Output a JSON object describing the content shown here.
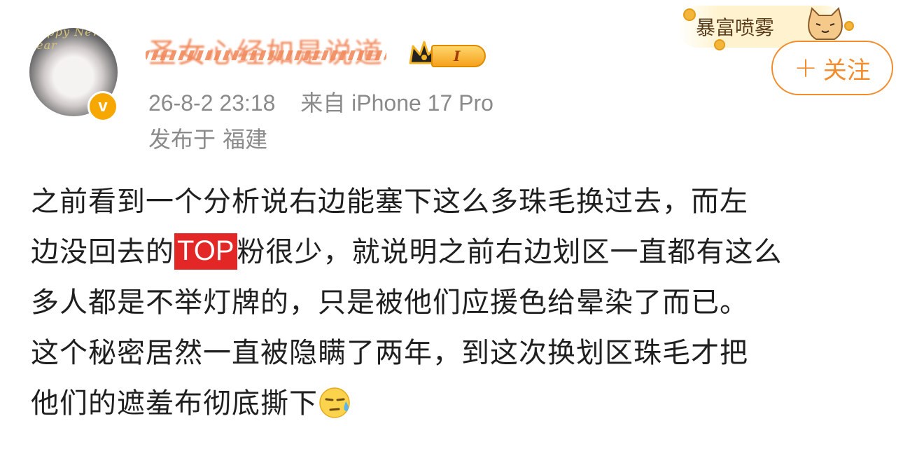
{
  "user": {
    "name": "圣女心经如是说道",
    "level_badge": "I",
    "verified_badge": "v"
  },
  "meta": {
    "datetime": "26-8-2 23:18",
    "source": "来自 iPhone 17 Pro",
    "location": "发布于 福建"
  },
  "decoration": {
    "text": "暴富喷雾"
  },
  "follow_button": {
    "plus": "+",
    "label": "关注"
  },
  "post": {
    "lines": [
      "之前看到一个分析说右边能塞下这么多珠毛换过去，而左",
      "边没回去的",
      "粉很少，就说明之前右边划区一直都有这么",
      "多人都是不举灯牌的，只是被他们应援色给晕染了而已。",
      "这个秘密居然一直被隐瞒了两年，到这次换划区珠毛才把",
      "他们的遮羞布彻底撕下"
    ],
    "highlight_tag": "TOP",
    "emoji": "downcast-sweat-face"
  },
  "colors": {
    "accent_orange": "#f28c2c",
    "tag_red": "#e32626",
    "meta_gray": "#8a8a8a"
  }
}
